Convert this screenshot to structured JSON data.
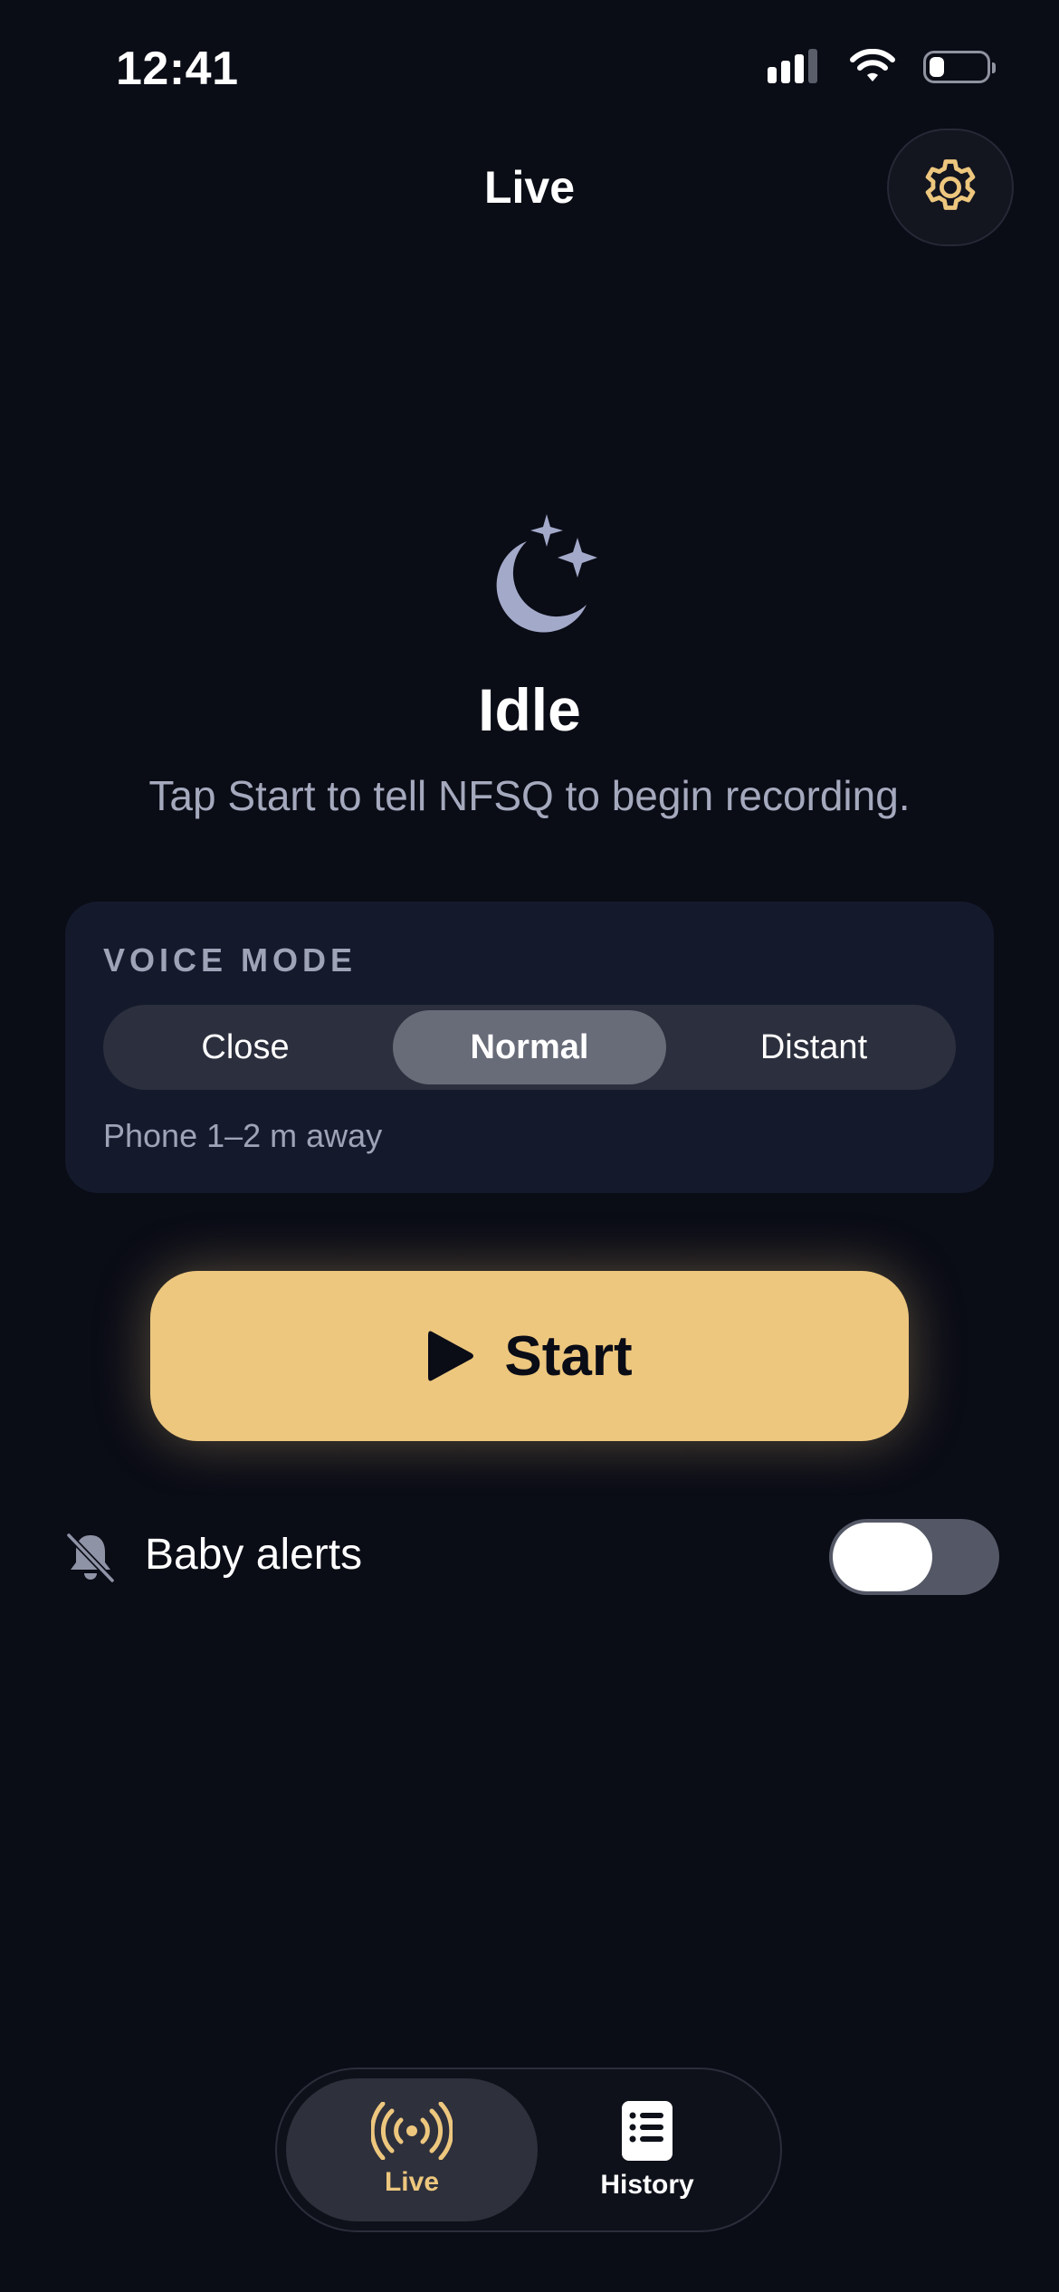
{
  "status_bar": {
    "time": "12:41",
    "icons": [
      "cellular-signal-icon",
      "wifi-icon",
      "battery-icon"
    ]
  },
  "header": {
    "title": "Live",
    "settings_icon": "gear-icon"
  },
  "state": {
    "icon": "moon-stars-icon",
    "title": "Idle",
    "subtitle": "Tap Start to tell NFSQ to begin recording."
  },
  "voice_mode": {
    "label": "VOICE MODE",
    "options": [
      "Close",
      "Normal",
      "Distant"
    ],
    "selected": "Normal",
    "note": "Phone 1–2 m away"
  },
  "start_button": {
    "label": "Start",
    "icon": "play-icon"
  },
  "baby_alerts": {
    "label": "Baby alerts",
    "icon": "bell-slash-icon",
    "enabled": false
  },
  "tabs": [
    {
      "label": "Live",
      "icon": "broadcast-icon",
      "active": true
    },
    {
      "label": "History",
      "icon": "list-icon",
      "active": false
    }
  ],
  "colors": {
    "background": "#0a0c16",
    "accent": "#edc77e",
    "card": "#141a2b",
    "muted_text": "#a5a9bd"
  }
}
